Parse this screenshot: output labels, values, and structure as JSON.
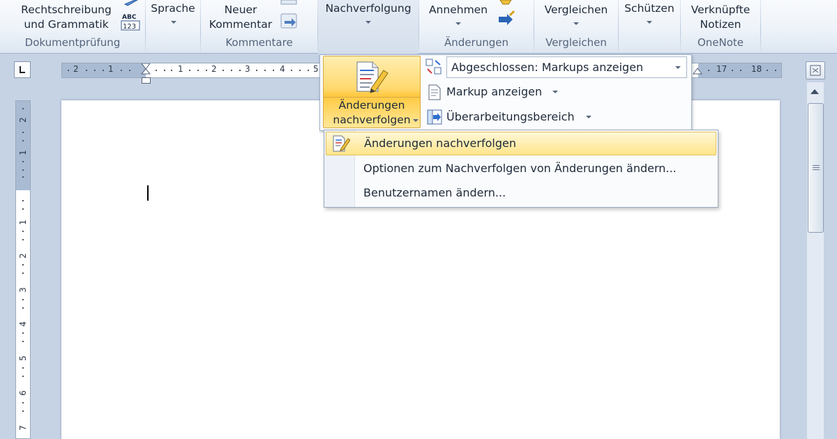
{
  "ribbon": {
    "groups": [
      {
        "label": "Dokumentprüfung",
        "buttons": [
          {
            "label": "Rechtschreibung\nund Grammatik"
          }
        ]
      },
      {
        "label": "",
        "buttons": [
          {
            "label": "Sprache"
          }
        ]
      },
      {
        "label": "Kommentare",
        "buttons": [
          {
            "label": "Neuer\nKommentar"
          }
        ]
      },
      {
        "label": "",
        "buttons": [
          {
            "label": "Nachverfolgung"
          }
        ]
      },
      {
        "label": "Änderungen",
        "buttons": [
          {
            "label": "Annehmen"
          }
        ]
      },
      {
        "label": "Vergleichen",
        "buttons": [
          {
            "label": "Vergleichen"
          }
        ]
      },
      {
        "label": "",
        "buttons": [
          {
            "label": "Schützen"
          }
        ]
      },
      {
        "label": "OneNote",
        "buttons": [
          {
            "label": "Verknüpfte\nNotizen"
          }
        ]
      }
    ],
    "abc_icon_text": "ABC",
    "abc_icon_num": "123"
  },
  "tracking_panel": {
    "big_button_label": "Änderungen\nnachverfolgen",
    "display_combo_value": "Abgeschlossen: Markups anzeigen",
    "show_markup_label": "Markup anzeigen",
    "reviewing_pane_label": "Überarbeitungsbereich"
  },
  "dropdown_menu": {
    "items": [
      {
        "label": "Änderungen nachverfolgen",
        "highlighted": true
      },
      {
        "label": "Optionen zum Nachverfolgen von Änderungen ändern...",
        "highlighted": false
      },
      {
        "label": "Benutzernamen ändern...",
        "highlighted": false
      }
    ]
  },
  "horizontal_ruler": {
    "left_numbers": [
      "2",
      "1",
      "1",
      "2",
      "3",
      "4",
      "5"
    ],
    "right_numbers": [
      "17",
      "18"
    ]
  },
  "vertical_ruler": {
    "numbers": [
      "2",
      "1",
      "1",
      "2",
      "3",
      "4",
      "5",
      "6",
      "7"
    ]
  },
  "colors": {
    "ribbon_bg": "#eef3f9",
    "workspace_bg": "#c6d3e5",
    "highlight": "#ffd970",
    "page": "#ffffff"
  }
}
